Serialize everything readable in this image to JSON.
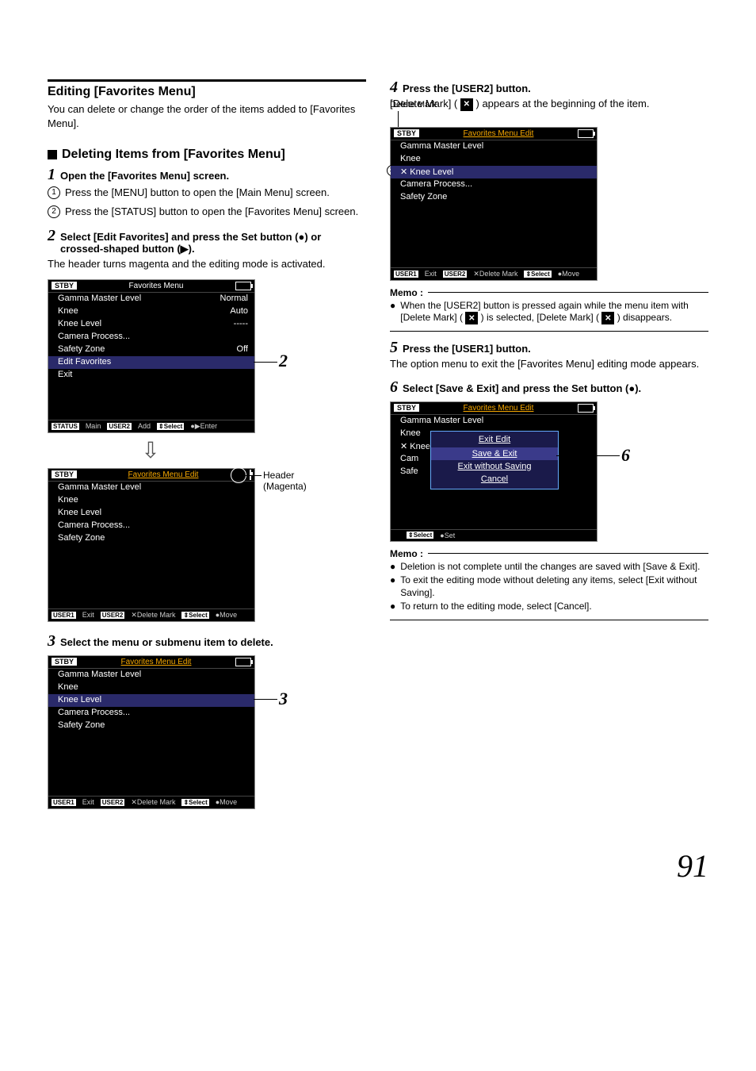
{
  "page_number": "91",
  "left": {
    "heading": "Editing [Favorites Menu]",
    "intro": "You can delete or change the order of the items added to [Favorites Menu].",
    "sub_heading": "Deleting Items from [Favorites Menu]",
    "step1": {
      "num": "1",
      "title": "Open the [Favorites Menu] screen."
    },
    "sub1": {
      "n": "1",
      "t": "Press the [MENU] button to open the [Main Menu] screen."
    },
    "sub2": {
      "n": "2",
      "t": "Press the [STATUS] button to open the [Favorites Menu] screen."
    },
    "step2": {
      "num": "2",
      "title": "Select [Edit Favorites] and press the Set button (●) or crossed-shaped button (▶)."
    },
    "step2_body": "The header turns magenta and the editing mode is activated.",
    "screen_a": {
      "stby": "STBY",
      "title": "Favorites Menu",
      "rows": [
        {
          "l": "Gamma Master Level",
          "r": "Normal"
        },
        {
          "l": "Knee",
          "r": "Auto"
        },
        {
          "l": "Knee Level",
          "r": "-----"
        },
        {
          "l": "Camera Process...",
          "r": ""
        },
        {
          "l": "Safety Zone",
          "r": "Off"
        },
        {
          "l": "Edit Favorites",
          "r": "",
          "hl": true
        },
        {
          "l": "Exit",
          "r": ""
        }
      ],
      "footer": [
        "STATUS",
        "Main",
        "USER2",
        "Add",
        "⇕Select",
        "●▶Enter"
      ]
    },
    "callout2": "2",
    "screen_b": {
      "stby": "STBY",
      "title": "Favorites Menu Edit",
      "rows": [
        {
          "l": "Gamma Master Level"
        },
        {
          "l": "Knee"
        },
        {
          "l": "Knee Level"
        },
        {
          "l": "Camera Process..."
        },
        {
          "l": "Safety Zone"
        }
      ],
      "footer": [
        "USER1",
        "Exit",
        "USER2",
        "✕Delete Mark",
        "⇕Select",
        "●Move"
      ]
    },
    "side_label1": "Header",
    "side_label2": "(Magenta)",
    "step3": {
      "num": "3",
      "title": "Select the menu or submenu item to delete."
    },
    "screen_c": {
      "stby": "STBY",
      "title": "Favorites Menu Edit",
      "rows": [
        {
          "l": "Gamma Master Level"
        },
        {
          "l": "Knee"
        },
        {
          "l": "Knee Level",
          "hl": true
        },
        {
          "l": "Camera Process..."
        },
        {
          "l": "Safety Zone"
        }
      ],
      "footer": [
        "USER1",
        "Exit",
        "USER2",
        "✕Delete Mark",
        "⇕Select",
        "●Move"
      ]
    },
    "callout3": "3"
  },
  "right": {
    "step4": {
      "num": "4",
      "title": "Press the [USER2] button."
    },
    "step4_body_a": "[Delete Mark] (",
    "step4_body_b": ") appears at the beginning of the item.",
    "del_caption": "Delete Mark",
    "screen_d": {
      "stby": "STBY",
      "title": "Favorites Menu Edit",
      "rows": [
        {
          "l": "Gamma Master Level"
        },
        {
          "l": "Knee"
        },
        {
          "l": "Knee Level",
          "hl": true,
          "marked": true
        },
        {
          "l": "Camera Process..."
        },
        {
          "l": "Safety Zone"
        }
      ],
      "footer": [
        "USER1",
        "Exit",
        "USER2",
        "✕Delete Mark",
        "⇕Select",
        "●Move"
      ]
    },
    "memo1": {
      "label": "Memo :",
      "item_a": "When the [USER2] button is pressed again while the menu item with [Delete Mark] (",
      "item_b": ") is selected, [Delete Mark] (",
      "item_c": ") disappears."
    },
    "step5": {
      "num": "5",
      "title": "Press the [USER1] button."
    },
    "step5_body": "The option menu to exit the [Favorites Menu] editing mode appears.",
    "step6": {
      "num": "6",
      "title": "Select [Save & Exit] and press the Set button (●)."
    },
    "screen_e": {
      "stby": "STBY",
      "title": "Favorites Menu Edit",
      "rows": [
        {
          "l": "Gamma Master Level"
        },
        {
          "l": "Knee"
        },
        {
          "l": "Knee",
          "marked": true
        },
        {
          "l": "Cam"
        },
        {
          "l": "Safe"
        }
      ],
      "popup": {
        "title": "Exit Edit",
        "items": [
          "Save & Exit",
          "Exit without Saving",
          "Cancel"
        ]
      },
      "footer": [
        "",
        "",
        "",
        "",
        "⇕Select",
        "●Set"
      ]
    },
    "callout6": "6",
    "memo2": {
      "label": "Memo :",
      "items": [
        "Deletion is not complete until the changes are saved with [Save & Exit].",
        "To exit the editing mode without deleting any items, select [Exit without Saving].",
        "To return to the editing mode, select [Cancel]."
      ]
    }
  }
}
